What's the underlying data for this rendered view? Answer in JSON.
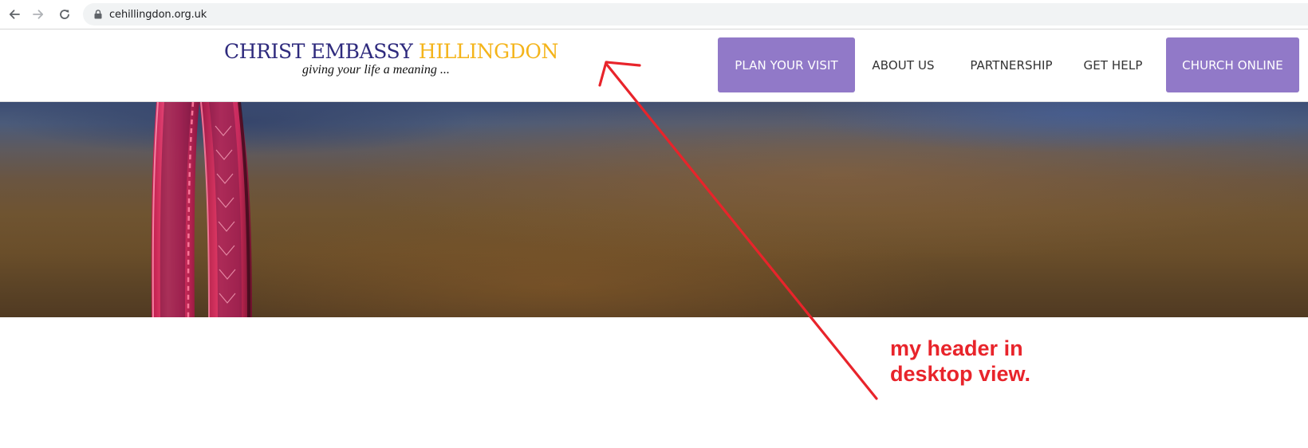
{
  "browser": {
    "url": "cehillingdon.org.uk",
    "icons": [
      "back-arrow-icon",
      "forward-arrow-icon",
      "reload-icon",
      "lock-icon"
    ]
  },
  "header": {
    "logo": {
      "name_part1": "CHRIST EMBASSY",
      "name_part2": "HILLINGDON",
      "tagline": "giving your life a meaning ..."
    },
    "nav": {
      "plan_visit": "PLAN YOUR VISIT",
      "about_us": "ABOUT US",
      "partnership": "PARTNERSHIP",
      "get_help": "GET HELP",
      "church_online": "CHURCH ONLINE"
    }
  },
  "annotation": {
    "line1": "my header in",
    "line2": "desktop view."
  },
  "colors": {
    "logo_primary": "#2e2a7d",
    "logo_accent": "#f4b41a",
    "nav_cta_background": "#9179c8",
    "nav_text": "#333333",
    "annotation_red": "#e8242b"
  }
}
